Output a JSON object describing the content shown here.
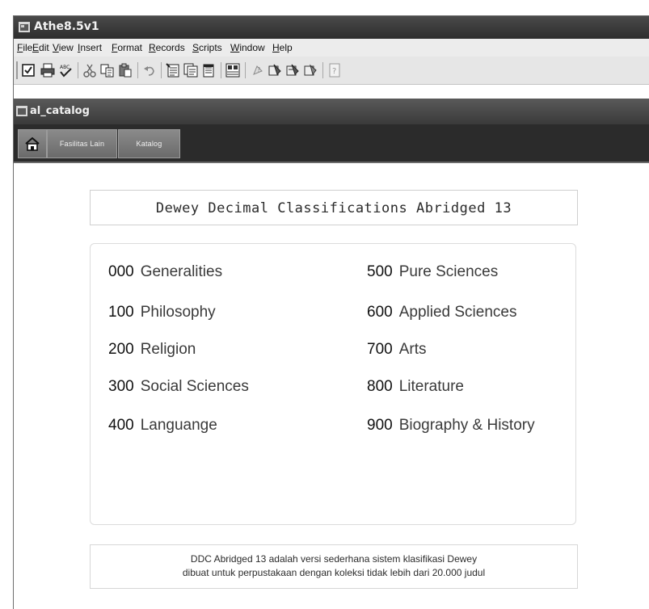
{
  "app": {
    "title": "Athe8.5v1"
  },
  "menubar": {
    "items": [
      "File",
      "Edit",
      "View",
      "Insert",
      "Format",
      "Records",
      "Scripts",
      "Window",
      "Help"
    ]
  },
  "toolbar": {
    "buttons": [
      "checkbox-icon",
      "print-icon",
      "spellcheck-icon",
      "cut-icon",
      "copy-icon",
      "paste-icon",
      "undo-icon",
      "new-record-icon",
      "duplicate-record-icon",
      "delete-record-icon",
      "table-view-icon",
      "help-icon",
      "script-icon",
      "script-2-icon",
      "script-3-icon",
      "info-icon"
    ]
  },
  "document": {
    "title": "al_catalog",
    "nav": {
      "tabs": [
        "Fasilitas Lain",
        "Katalog"
      ]
    }
  },
  "content": {
    "heading": "Dewey Decimal Classifications  Abridged 13",
    "classes": [
      {
        "code": "000",
        "name": "Generalities"
      },
      {
        "code": "100",
        "name": "Philosophy"
      },
      {
        "code": "200",
        "name": "Religion"
      },
      {
        "code": "300",
        "name": "Social Sciences"
      },
      {
        "code": "400",
        "name": "Languange"
      },
      {
        "code": "500",
        "name": "Pure Sciences"
      },
      {
        "code": "600",
        "name": "Applied Sciences"
      },
      {
        "code": "700",
        "name": "Arts"
      },
      {
        "code": "800",
        "name": "Literature"
      },
      {
        "code": "900",
        "name": "Biography & History"
      }
    ],
    "note": {
      "line1": "DDC Abridged 13  adalah versi sederhana sistem klasifikasi Dewey",
      "line2": "dibuat untuk perpustakaan dengan koleksi tidak lebih dari 20.000 judul"
    }
  }
}
